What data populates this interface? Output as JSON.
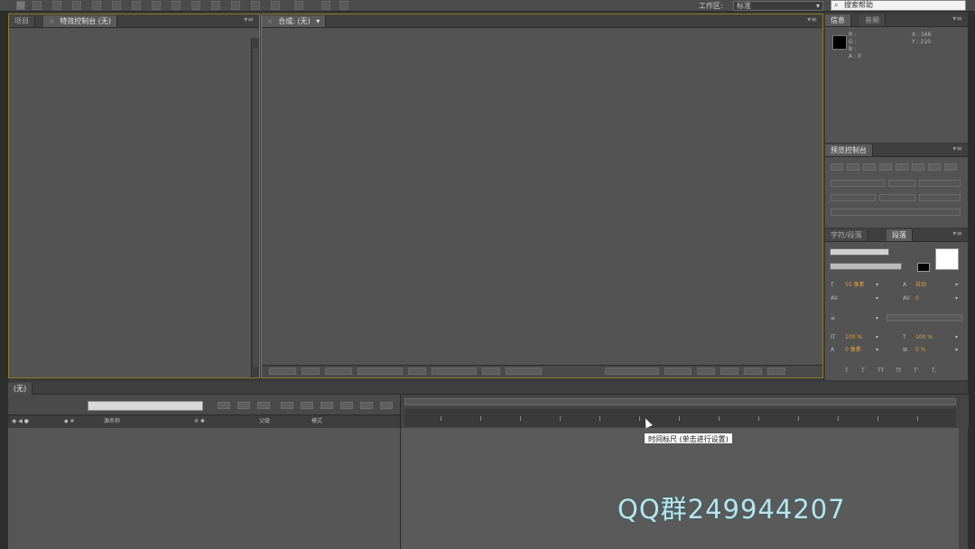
{
  "toolbar": {
    "workspace_label": "工作区:",
    "workspace_value": "标准",
    "search_placeholder": "搜索帮助"
  },
  "project_panel": {
    "tabs": [
      "项目",
      "特效控制台 (无)"
    ]
  },
  "comp_panel": {
    "tabs": [
      "合成: (无)"
    ]
  },
  "info_panel": {
    "tabs": [
      "信息",
      "音频"
    ],
    "r_label": "R :",
    "g_label": "G :",
    "b_label": "B :",
    "a_label": "A : 0",
    "x_label": "X : 166",
    "y_label": "Y : 210"
  },
  "preview_panel": {
    "tab": "预览控制台"
  },
  "character_panel": {
    "tabs": [
      "字符/段落",
      "段落"
    ],
    "font_size": "55 像素",
    "leading": "自动",
    "tracking": "0",
    "vertical_scale": "100 %",
    "horizontal_scale": "100 %",
    "baseline_shift": "0 像素",
    "tsume": "0 %"
  },
  "timeline": {
    "tab": "(无)",
    "columns": [
      "源名称",
      "父级",
      "模式"
    ]
  },
  "tooltip": {
    "text": "时间标尺 (单击进行设置)"
  },
  "watermark": {
    "text": "QQ群249944207"
  },
  "colors": {
    "panel_bg": "#535353",
    "frame_accent": "#8c7a2a",
    "watermark": "#bfe2e8"
  }
}
